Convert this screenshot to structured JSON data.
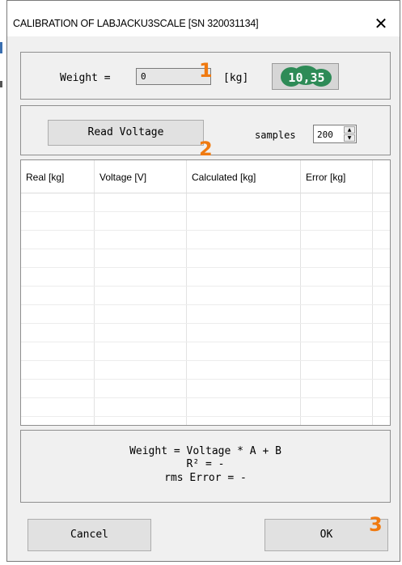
{
  "window": {
    "title": "CALIBRATION OF LABJACKU3SCALE [SN 320031134]",
    "close_glyph": "✕"
  },
  "weight": {
    "label": "Weight =",
    "value": "0",
    "unit": "[kg]",
    "badge_icon": "green-number-badge-icon",
    "badge_text": "10,35"
  },
  "callouts": [
    "1",
    "2",
    "3"
  ],
  "read": {
    "button_label": "Read Voltage",
    "samples_label": "samples",
    "samples_value": "200"
  },
  "table": {
    "columns": [
      "Real [kg]",
      "Voltage [V]",
      "Calculated [kg]",
      "Error [kg]"
    ],
    "rows": []
  },
  "formula": {
    "line1": "Weight = Voltage * A + B",
    "line2": "R² = -",
    "line3": "rms Error = -"
  },
  "buttons": {
    "cancel": "Cancel",
    "ok": "OK"
  },
  "colors": {
    "callout": "#f07a10",
    "badge_green": "#2e8b57"
  }
}
